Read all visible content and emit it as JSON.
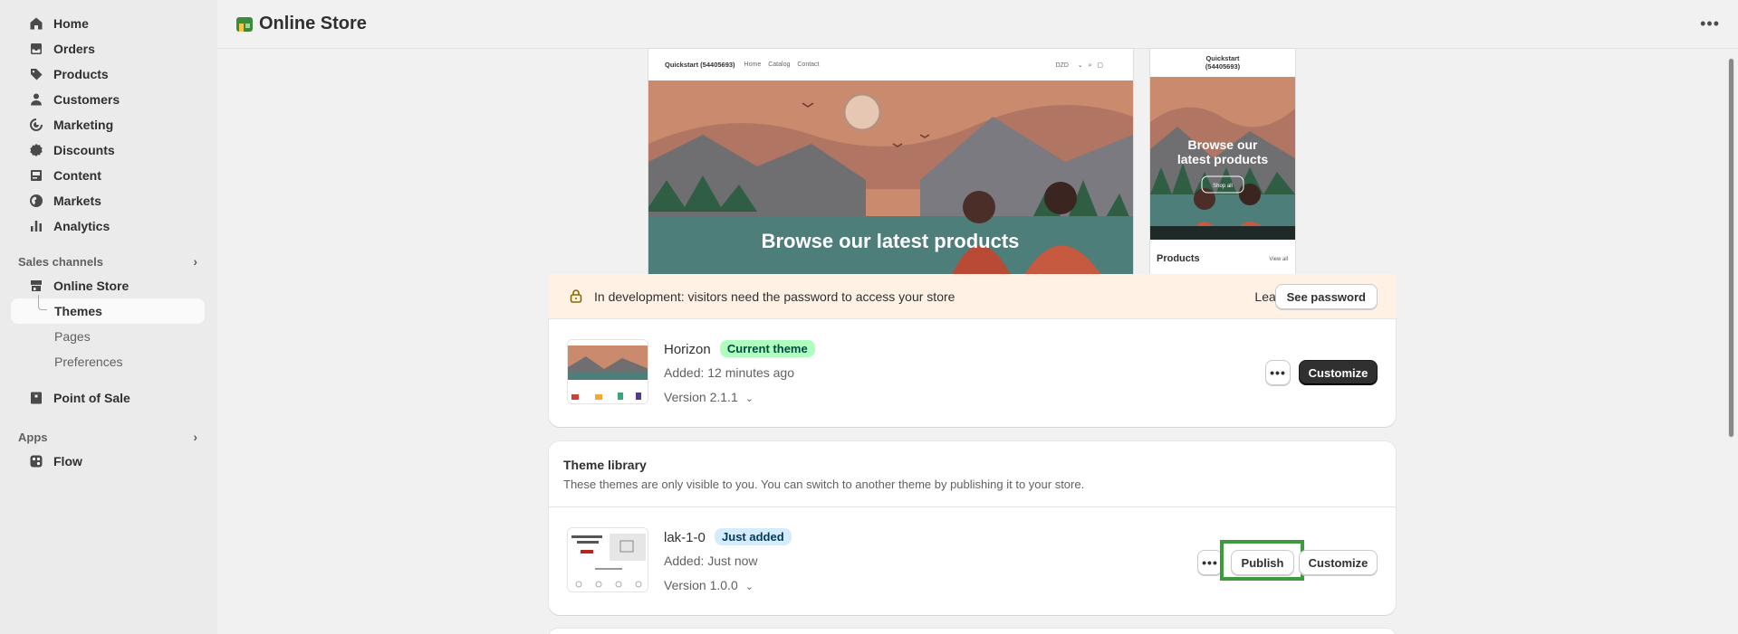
{
  "sidebar": {
    "items": [
      {
        "label": "Home",
        "icon": "home-icon"
      },
      {
        "label": "Orders",
        "icon": "orders-icon"
      },
      {
        "label": "Products",
        "icon": "tag-icon"
      },
      {
        "label": "Customers",
        "icon": "person-icon"
      },
      {
        "label": "Marketing",
        "icon": "target-icon"
      },
      {
        "label": "Discounts",
        "icon": "discount-icon"
      },
      {
        "label": "Content",
        "icon": "content-icon"
      },
      {
        "label": "Markets",
        "icon": "globe-icon"
      },
      {
        "label": "Analytics",
        "icon": "bar-chart-icon"
      }
    ],
    "sales_channels_title": "Sales channels",
    "online_store": "Online Store",
    "sub_items": [
      "Themes",
      "Pages",
      "Preferences"
    ],
    "point_of_sale": "Point of Sale",
    "apps_title": "Apps",
    "flow": "Flow"
  },
  "header": {
    "title": "Online Store"
  },
  "preview": {
    "desktop": {
      "store_name": "Quickstart (54405693)",
      "nav": [
        "Home",
        "Catalog",
        "Contact"
      ],
      "currency": "DZD",
      "hero_text": "Browse our latest products"
    },
    "mobile": {
      "store_name_line1": "Quickstart",
      "store_name_line2": "(54405693)",
      "hero_line1": "Browse our",
      "hero_line2": "latest products",
      "shop_all": "Shop all",
      "products": "Products",
      "view_all": "View all"
    }
  },
  "banner": {
    "message": "In development: visitors need the password to access your store",
    "learn_more": "Learn more",
    "see_password": "See password"
  },
  "current_theme": {
    "name": "Horizon",
    "badge": "Current theme",
    "added": "Added: 12 minutes ago",
    "version": "Version 2.1.1",
    "customize": "Customize"
  },
  "library": {
    "title": "Theme library",
    "description": "These themes are only visible to you. You can switch to another theme by publishing it to your store.",
    "theme": {
      "name": "lak-1-0",
      "badge": "Just added",
      "added": "Added: Just now",
      "version": "Version 1.0.0",
      "publish": "Publish",
      "customize": "Customize"
    }
  },
  "colors": {
    "highlight": "#3d9a3d",
    "current_badge": "#affebf",
    "new_badge": "#d5ebff",
    "banner_bg": "#fff1e3"
  }
}
